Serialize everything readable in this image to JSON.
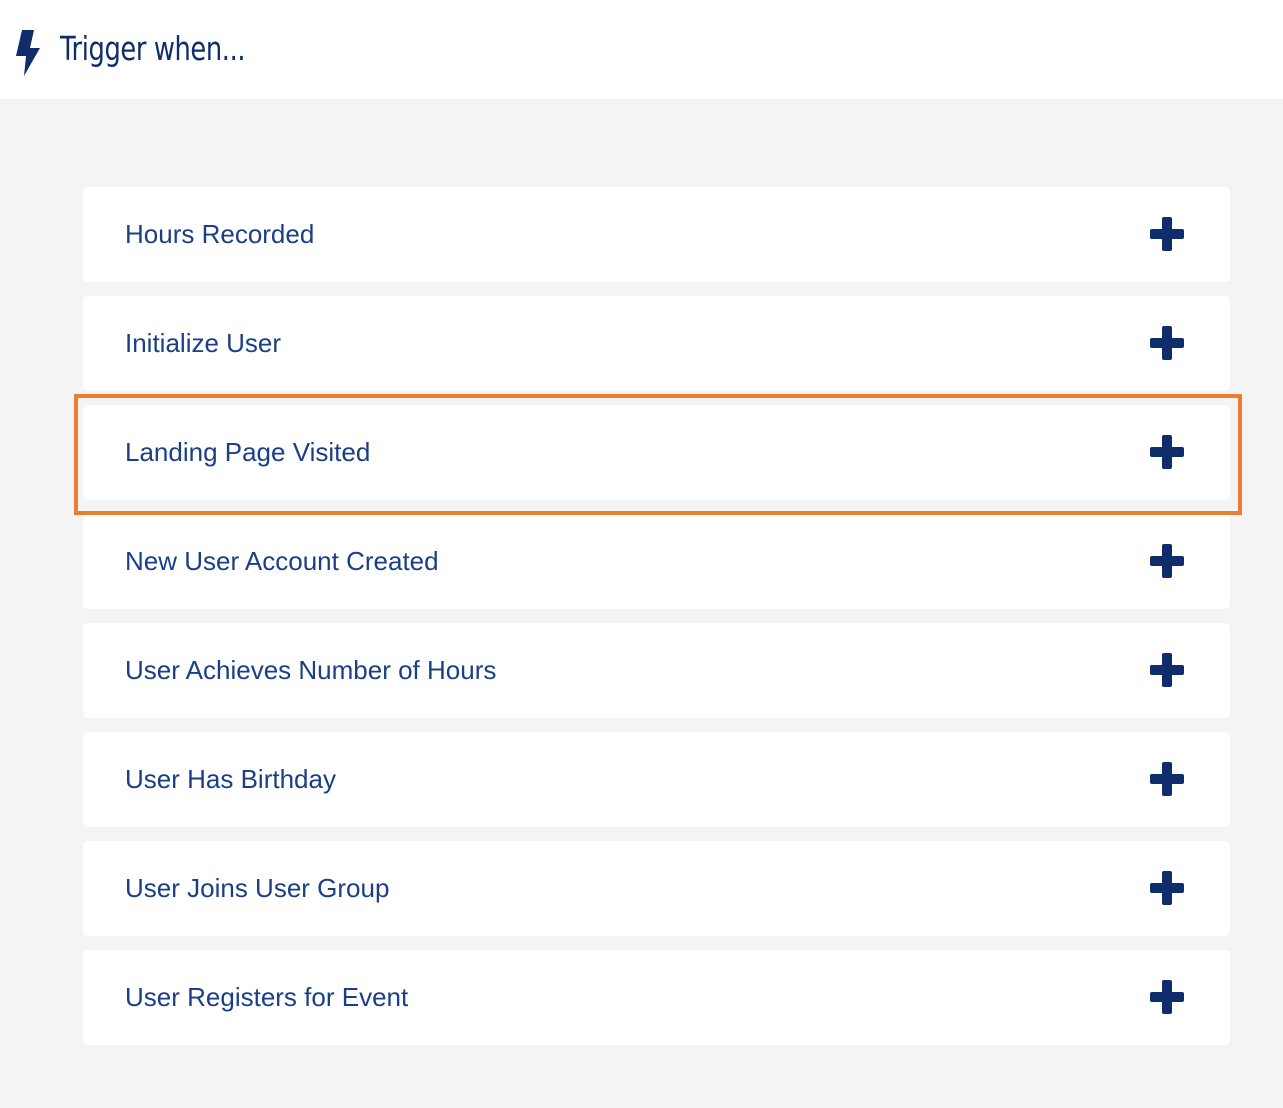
{
  "header": {
    "title": "Trigger when...",
    "icon": "lightning-bolt-icon"
  },
  "colors": {
    "accent": "#0f2d6b",
    "label": "#1b3f86",
    "highlight": "#ed7d31",
    "background": "#f4f4f4"
  },
  "triggers": {
    "items": [
      {
        "label": "Hours Recorded",
        "icon": "plus-icon"
      },
      {
        "label": "Initialize User",
        "icon": "plus-icon"
      },
      {
        "label": "Landing Page Visited",
        "icon": "plus-icon",
        "highlighted": true
      },
      {
        "label": "New User Account Created",
        "icon": "plus-icon"
      },
      {
        "label": "User Achieves Number of Hours",
        "icon": "plus-icon"
      },
      {
        "label": "User Has Birthday",
        "icon": "plus-icon"
      },
      {
        "label": "User Joins User Group",
        "icon": "plus-icon"
      },
      {
        "label": "User Registers for Event",
        "icon": "plus-icon"
      }
    ]
  }
}
